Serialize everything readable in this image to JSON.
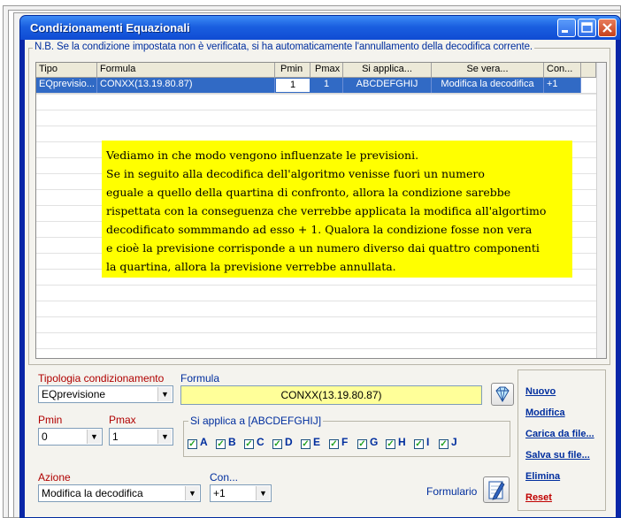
{
  "window": {
    "title": "Condizionamenti Equazionali"
  },
  "note_bar": "N.B. Se la condizione impostata non è verificata, si ha automaticamente l'annullamento della decodifica corrente.",
  "grid": {
    "headers": [
      "Tipo",
      "Formula",
      "Pmin",
      "Pmax",
      "Si applica...",
      "Se vera...",
      "Con..."
    ],
    "rows": [
      [
        "EQprevisio...",
        "CONXX(13.19.80.87)",
        "1",
        "1",
        "ABCDEFGHIJ",
        "Modifica la decodifica",
        "+1"
      ]
    ]
  },
  "note_lines": [
    "Vediamo in che modo vengono influenzate le previsioni.",
    "Se in seguito alla decodifica dell'algoritmo venisse fuori un numero",
    "eguale a quello della quartina di confronto, allora la condizione sarebbe",
    "rispettata con la conseguenza che verrebbe applicata la modifica all'algortimo",
    "decodificato sommmando ad esso + 1. Qualora la condizione fosse non vera",
    "e cioè la previsione corrisponde a un numero diverso dai quattro componenti",
    "la quartina, allora la previsione verrebbe annullata."
  ],
  "form": {
    "tipologia_label": "Tipologia condizionamento",
    "tipologia_value": "EQprevisione",
    "formula_label": "Formula",
    "formula_value": "CONXX(13.19.80.87)",
    "pmin_label": "Pmin",
    "pmin_value": "0",
    "pmax_label": "Pmax",
    "pmax_value": "1",
    "si_applica_label": "Si applica a [ABCDEFGHIJ]",
    "letters": [
      "A",
      "B",
      "C",
      "D",
      "E",
      "F",
      "G",
      "H",
      "I",
      "J"
    ],
    "azione_label": "Azione",
    "azione_value": "Modifica la decodifica",
    "con_label": "Con...",
    "con_value": "+1",
    "formulario_label": "Formulario"
  },
  "actions": {
    "nuovo": "Nuovo",
    "modifica": "Modifica",
    "carica": "Carica da file...",
    "salva": "Salva su file...",
    "elimina": "Elimina",
    "reset": "Reset"
  },
  "icons": {
    "minimize": "minimize-icon",
    "maximize": "maximize-icon",
    "close": "close-icon",
    "gem": "diamond-icon",
    "formulario": "notebook-pen-icon"
  },
  "colors": {
    "titlebar": "#1a5fe0",
    "note_bg": "#ffff00",
    "formula_bg": "#ffff99",
    "selection": "#316ac5",
    "label_red": "#b00000",
    "label_blue": "#002e9e"
  }
}
